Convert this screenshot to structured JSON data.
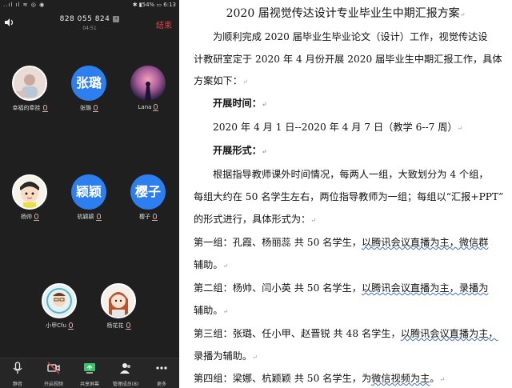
{
  "status_bar": {
    "left": "..ıl ıl ≋ ◎ ◉",
    "right": "✱ ▮54% ▭ 6:13"
  },
  "meeting": {
    "id": "828 055 824",
    "time": "04:51",
    "end_label": "结束"
  },
  "participants": [
    {
      "name": "幸福的牵挂",
      "avatar": "photo"
    },
    {
      "name": "张璐",
      "avatar_text": "张璐"
    },
    {
      "name": "Lana",
      "avatar": "photo"
    },
    {
      "name": "杨帅",
      "avatar": "cartoon"
    },
    {
      "name": "杭颖颖",
      "avatar_text": "颖颖"
    },
    {
      "name": "樱子",
      "avatar_text": "樱子"
    },
    {
      "name": "小甲Cfu",
      "avatar": "photo"
    },
    {
      "name": "杨花花",
      "avatar": "photo"
    }
  ],
  "toolbar": [
    {
      "label": "静音",
      "icon": "mic-icon"
    },
    {
      "label": "开启视频",
      "icon": "video-off-icon"
    },
    {
      "label": "共享屏幕",
      "icon": "share-screen-icon"
    },
    {
      "label": "管理成员(8)",
      "icon": "members-icon"
    },
    {
      "label": "更多",
      "icon": "more-icon"
    }
  ],
  "doc": {
    "title": "2020 届视觉传达设计专业毕业生中期汇报方案",
    "intro_1": "为顺利完成 2020 届毕业生毕业论文（设计）工作，视觉传达设",
    "intro_2": "计教研室定于 2020 年 4 月份开展 2020 届毕业生中期汇报工作，具体",
    "intro_3": "方案如下：",
    "time_heading": "开展时间：",
    "time_text": "2020 年 4 月 1 日--2020 年 4 月 7 日（教学 6--7 周）",
    "form_heading": "开展形式：",
    "form_1": "根据指导教师课外时间情况，每两人一组，大致划分为 4 个组，",
    "form_2": "每组大约在 50 名学生左右，两位指导教师为一组；每组以“汇报+PPT”",
    "form_3": "的形式进行，具体形式为：",
    "g1_a": "第一组：孔霞、杨丽蕊  共 50 名学生，",
    "g1_b": "以腾讯会议直播为主，微信群",
    "g1_c": "辅助。",
    "g2_a": "第二组：杨帅、闫小英  共 50 名学生，",
    "g2_b": "以腾讯会议直播为主，录播为",
    "g2_c": "辅助。",
    "g3_a": "第三组：张璐、任小甲、赵晋锐  共 48 名学生，",
    "g3_b": "以腾讯会议直播为主，",
    "g3_c": "录播为辅助。",
    "g4_a": "第四组：梁娜、杭颖颖  共 50 名学生，为",
    "g4_b": "微信视频为主",
    "g4_c": "。"
  }
}
